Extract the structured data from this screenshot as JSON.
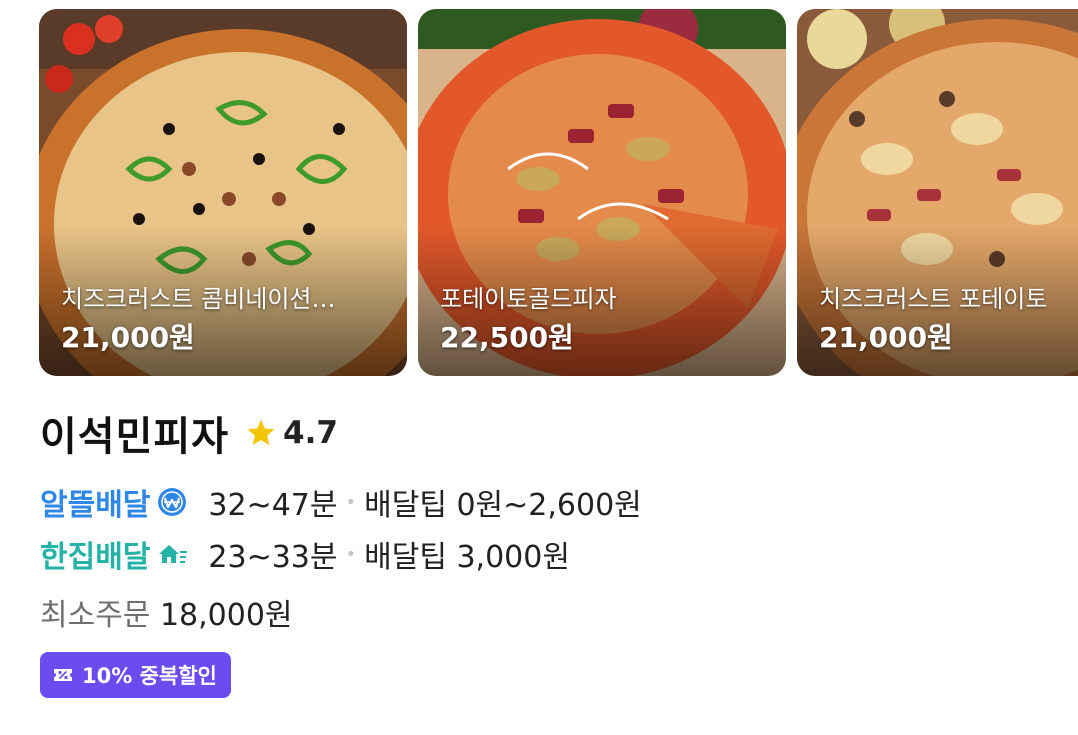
{
  "menu_items": [
    {
      "name": "치즈크러스트 콤비네이션…",
      "price": "21,000원"
    },
    {
      "name": "포테이토골드피자",
      "price": "22,500원"
    },
    {
      "name": "치즈크러스트 포테이토",
      "price": "21,000원"
    }
  ],
  "store": {
    "name": "이석민피자",
    "rating": "4.7",
    "star_color": "#f5c400"
  },
  "delivery": [
    {
      "label": "알뜰배달",
      "icon": "won-check-badge-icon",
      "time": "32~47분",
      "tip": "배달팁 0원~2,600원",
      "color": "#2f87e8"
    },
    {
      "label": "한집배달",
      "icon": "house-speed-icon",
      "time": "23~33분",
      "tip": "배달팁 3,000원",
      "color": "#25b3a8"
    }
  ],
  "min_order": {
    "label": "최소주문",
    "value": "18,000원"
  },
  "coupon": {
    "text": "10% 중복할인",
    "color": "#6a4cf0",
    "icon": "coupon-percent-icon"
  }
}
